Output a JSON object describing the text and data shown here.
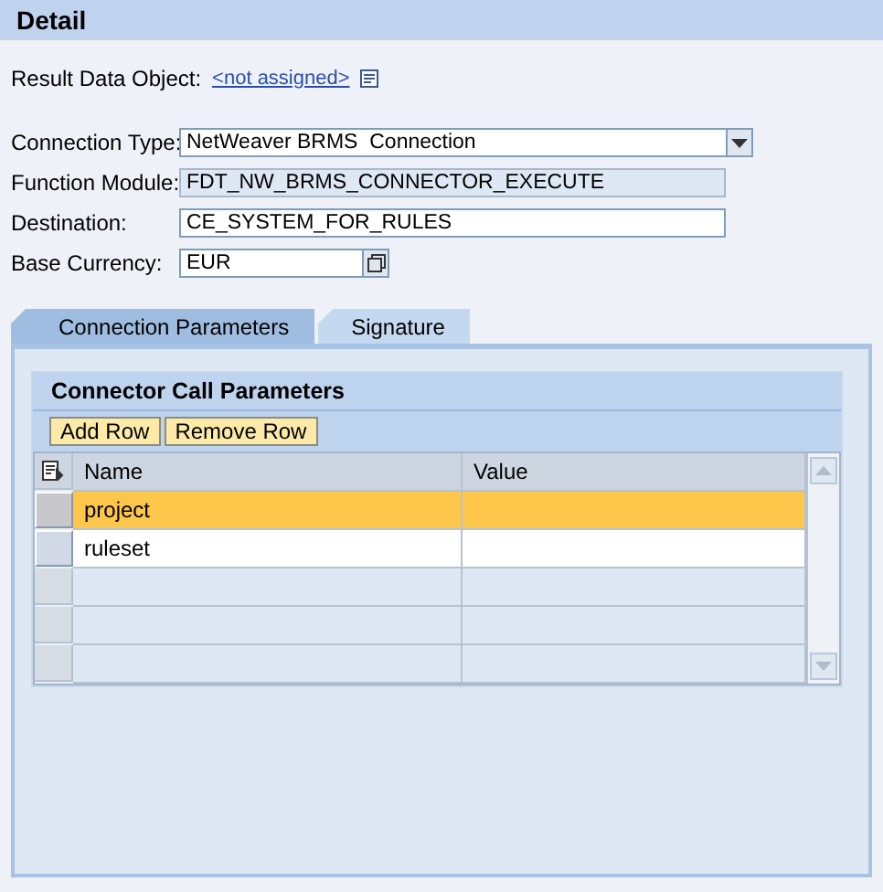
{
  "header": {
    "title": "Detail"
  },
  "result_data_object": {
    "label": "Result Data Object:",
    "link": "<not assigned>"
  },
  "fields": [
    {
      "kind": "dropdown",
      "label": "Connection Type:",
      "value": "NetWeaver BRMS  Connection"
    },
    {
      "kind": "readonly",
      "label": "Function Module:",
      "value": "FDT_NW_BRMS_CONNECTOR_EXECUTE"
    },
    {
      "kind": "text",
      "label": "Destination:",
      "value": "CE_SYSTEM_FOR_RULES"
    },
    {
      "kind": "valuehelp",
      "label": "Base Currency:",
      "value": "EUR"
    }
  ],
  "tabs": [
    {
      "label": "Connection Parameters",
      "selected": true
    },
    {
      "label": "Signature",
      "selected": false
    }
  ],
  "group": {
    "title": "Connector Call Parameters",
    "buttons": [
      "Add Row",
      "Remove Row"
    ],
    "table": {
      "columns": [
        "Name",
        "Value"
      ],
      "rows": [
        {
          "name": "project",
          "selected": true
        },
        {
          "name": "ruleset",
          "selected": false
        }
      ]
    }
  }
}
